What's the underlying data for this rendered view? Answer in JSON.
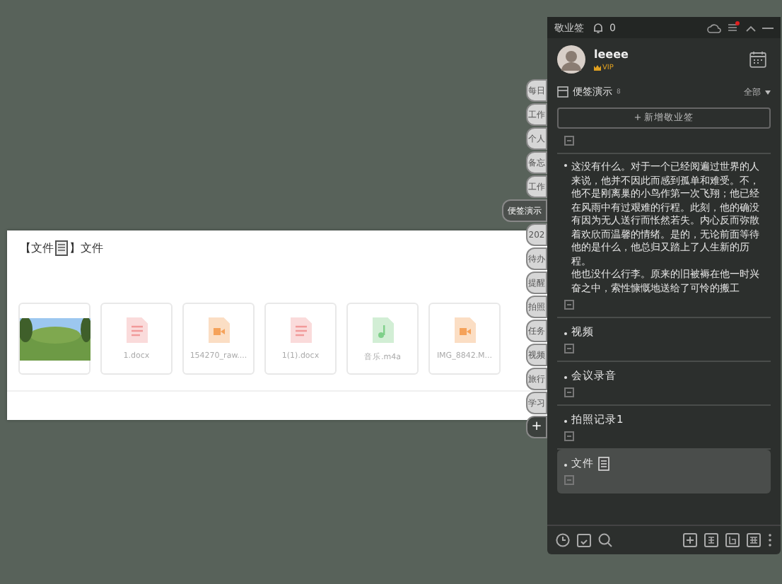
{
  "dialog": {
    "title_before": "【文件",
    "title_after": "】文件",
    "files": [
      {
        "kind": "photo"
      },
      {
        "kind": "doc",
        "name": "1.docx"
      },
      {
        "kind": "video",
        "name": "154270_raw...."
      },
      {
        "kind": "doc",
        "name": "1(1).docx"
      },
      {
        "kind": "audio",
        "name": "音乐.m4a"
      },
      {
        "kind": "video",
        "name": "IMG_8842.M..."
      }
    ]
  },
  "side_tabs": [
    {
      "label": "每日",
      "selected": false
    },
    {
      "label": "工作",
      "selected": false
    },
    {
      "label": "个人",
      "selected": false
    },
    {
      "label": "备忘",
      "selected": false
    },
    {
      "label": "工作",
      "selected": false
    },
    {
      "label": "便签演示",
      "selected": true
    },
    {
      "label": "202",
      "selected": false
    },
    {
      "label": "待办",
      "selected": false
    },
    {
      "label": "提醒",
      "selected": false
    },
    {
      "label": "拍照",
      "selected": false
    },
    {
      "label": "任务",
      "selected": false
    },
    {
      "label": "视频",
      "selected": false
    },
    {
      "label": "旅行",
      "selected": false
    },
    {
      "label": "学习",
      "selected": false
    }
  ],
  "add_tab": "+",
  "panel": {
    "app_name": "敬业签",
    "bell_count": "0",
    "user": {
      "name": "leeee",
      "badge": "VIP"
    },
    "notebook": {
      "name": "便签演示",
      "count": "8",
      "filter": "全部"
    },
    "add_button": "+ 新增敬业签",
    "notes": [
      {
        "selected": false
      },
      {
        "paragraphs": [
          "这没有什么。对于一个已经阅遍过世界的人来说，他并不因此而感到孤单和难受。不，他不是刚离巢的小鸟作第一次飞翔；他已经在风雨中有过艰难的行程。此刻，他的确没有因为无人送行而怅然若失。内心反而弥散着欢欣而温馨的情绪。是的，无论前面等待他的是什么，他总归又踏上了人生新的历程。",
          "他也没什么行李。原来的旧被褥在他一时兴奋之中，索性慷慨地送给了可怜的搬工"
        ],
        "selected": false
      },
      {
        "title": "视频",
        "selected": false
      },
      {
        "title": "会议录音",
        "selected": false
      },
      {
        "title": "拍照记录1",
        "selected": false
      },
      {
        "title": "文件",
        "file_icon": true,
        "selected": true
      }
    ]
  }
}
